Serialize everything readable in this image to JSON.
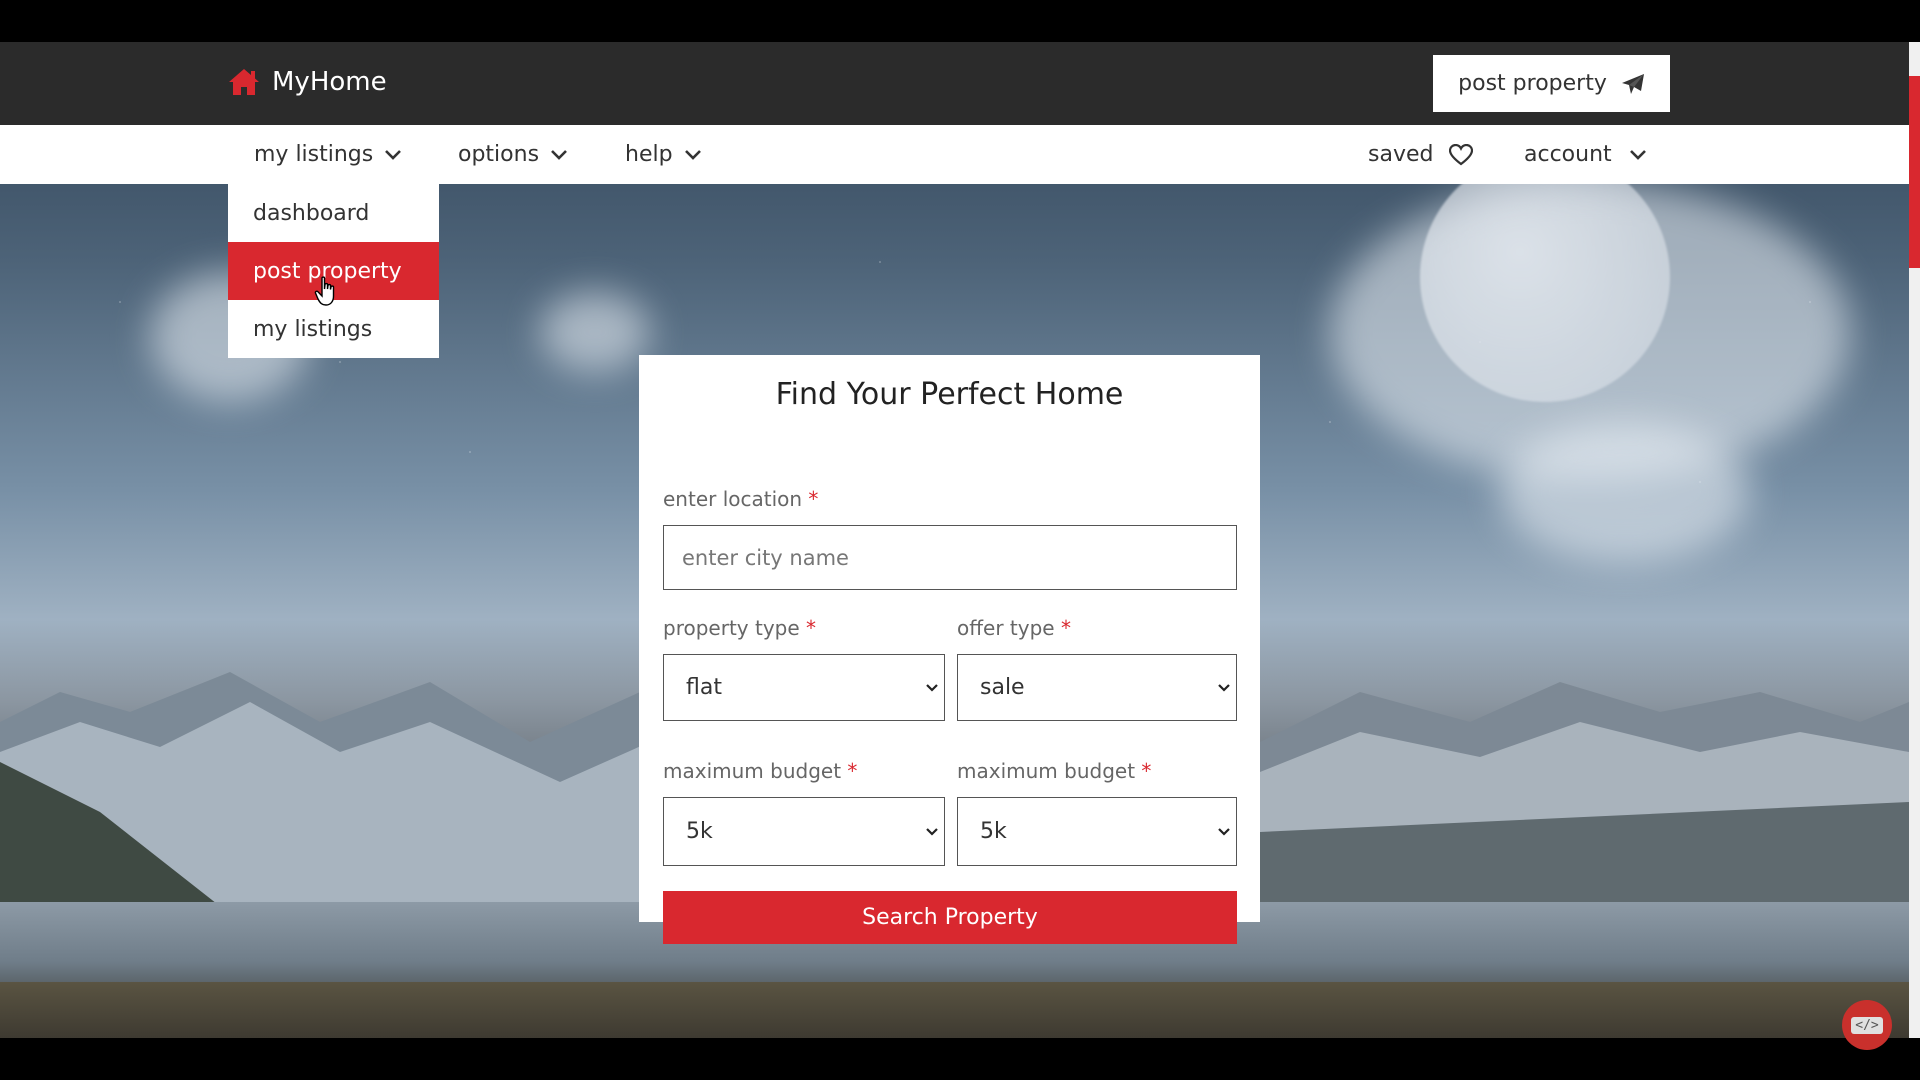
{
  "header": {
    "brand": "MyHome",
    "post_property_button": "post property"
  },
  "nav": {
    "left": [
      {
        "label": "my listings"
      },
      {
        "label": "options"
      },
      {
        "label": "help"
      }
    ],
    "saved": "saved",
    "account": "account"
  },
  "dropdown": {
    "items": [
      "dashboard",
      "post property",
      "my listings"
    ],
    "active_index": 1
  },
  "search_form": {
    "title": "Find Your Perfect Home",
    "location_label": "enter location",
    "location_placeholder": "enter city name",
    "location_value": "",
    "required_mark": "*",
    "property_type_label": "property type",
    "property_type_value": "flat",
    "offer_type_label": "offer type",
    "offer_type_value": "sale",
    "budget_min_label": "maximum budget",
    "budget_min_value": "5k",
    "budget_max_label": "maximum budget",
    "budget_max_value": "5k",
    "submit_label": "Search Property"
  },
  "floating": {
    "code_label": "</>"
  },
  "colors": {
    "accent": "#d9282f",
    "topbar": "#2b2b2b"
  }
}
